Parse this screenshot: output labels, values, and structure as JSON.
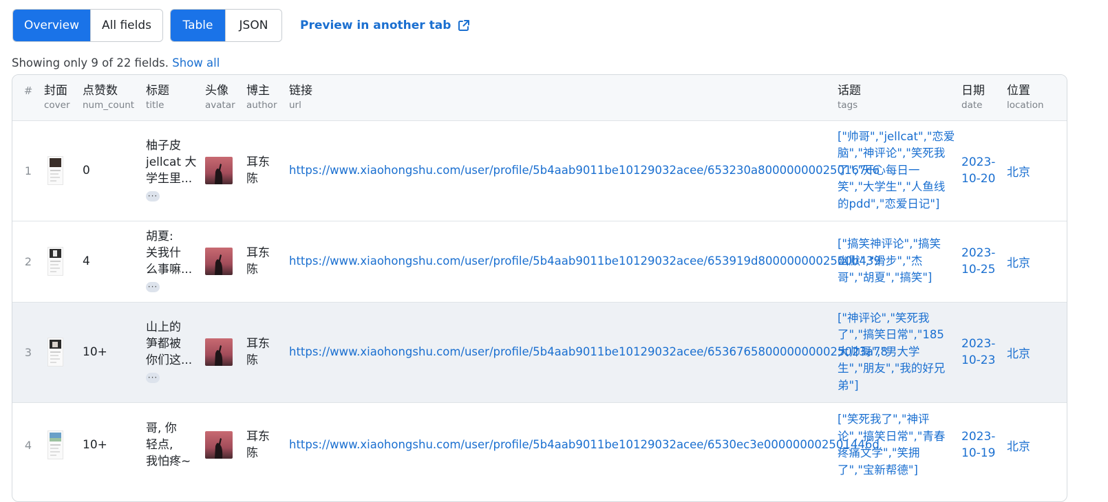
{
  "toolbar": {
    "view_tabs": [
      {
        "label": "Overview",
        "active": true
      },
      {
        "label": "All fields",
        "active": false
      }
    ],
    "format_tabs": [
      {
        "label": "Table",
        "active": true
      },
      {
        "label": "JSON",
        "active": false
      }
    ],
    "preview_label": "Preview in another tab"
  },
  "info": {
    "text": "Showing only 9 of 22 fields.",
    "show_all": "Show all"
  },
  "table": {
    "index_header": "#",
    "columns": [
      {
        "zh": "封面",
        "en": "cover"
      },
      {
        "zh": "点赞数",
        "en": "num_count"
      },
      {
        "zh": "标题",
        "en": "title"
      },
      {
        "zh": "头像",
        "en": "avatar"
      },
      {
        "zh": "博主",
        "en": "author"
      },
      {
        "zh": "链接",
        "en": "url"
      },
      {
        "zh": "话题",
        "en": "tags"
      },
      {
        "zh": "日期",
        "en": "date"
      },
      {
        "zh": "位置",
        "en": "location"
      }
    ],
    "ellipsis": "···",
    "rows": [
      {
        "index": "1",
        "num_count": "0",
        "title": [
          "柚子皮",
          "jellcat 大",
          "学生里..."
        ],
        "author": [
          "耳东",
          "陈"
        ],
        "url": "https://www.xiaohongshu.com/user/profile/5b4aab9011be10129032acee/653230a800000000250167c6",
        "tags": [
          "[\"帅哥\",\"jellcat\",\"恋爱",
          "脑\",\"神评论\",\"笑死我",
          "了\",\"开心每日一",
          "笑\",\"大学生\",\"人鱼线",
          "的pdd\",\"恋爱日记\"]"
        ],
        "date": [
          "2023-",
          "10-20"
        ],
        "location": "北京",
        "highlight": false
      },
      {
        "index": "2",
        "num_count": "4",
        "title": [
          "胡夏:",
          "关我什",
          "么事嘛..."
        ],
        "author": [
          "耳东",
          "陈"
        ],
        "url": "https://www.xiaohongshu.com/user/profile/5b4aab9011be10129032acee/653919d8000000002500b439",
        "tags": [
          "[\"搞笑神评论\",\"搞笑",
          "幽默\",\"滑步\",\"杰",
          "哥\",\"胡夏\",\"搞笑\"]"
        ],
        "date": [
          "2023-",
          "10-25"
        ],
        "location": "北京",
        "highlight": false
      },
      {
        "index": "3",
        "num_count": "10+",
        "title": [
          "山上的",
          "笋都被",
          "你们这..."
        ],
        "author": [
          "耳东",
          "陈"
        ],
        "url": "https://www.xiaohongshu.com/user/profile/5b4aab9011be10129032acee/6536765800000000025023a78",
        "tags": [
          "[\"神评论\",\"笑死我",
          "了\",\"搞笑日常\",\"185",
          "大帅哥\",\"男大学",
          "生\",\"朋友\",\"我的好兄",
          "弟\"]"
        ],
        "date": [
          "2023-",
          "10-23"
        ],
        "location": "北京",
        "highlight": true
      },
      {
        "index": "4",
        "num_count": "10+",
        "title": [
          "哥, 你",
          "轻点,",
          "我怕疼~"
        ],
        "author": [
          "耳东",
          "陈"
        ],
        "url": "https://www.xiaohongshu.com/user/profile/5b4aab9011be10129032acee/6530ec3e000000002501446d",
        "tags": [
          "[\"笑死我了\",\"神评",
          "论\",\"搞笑日常\",\"青春",
          "疼痛文学\",\"笑拥",
          "了\",\"宝新帮德\"]"
        ],
        "date": [
          "2023-",
          "10-19"
        ],
        "location": "北京",
        "highlight": false
      }
    ]
  },
  "colors": {
    "accent": "#1a73e8",
    "link": "#1a6fd0",
    "row_highlight": "#eef1f5"
  }
}
